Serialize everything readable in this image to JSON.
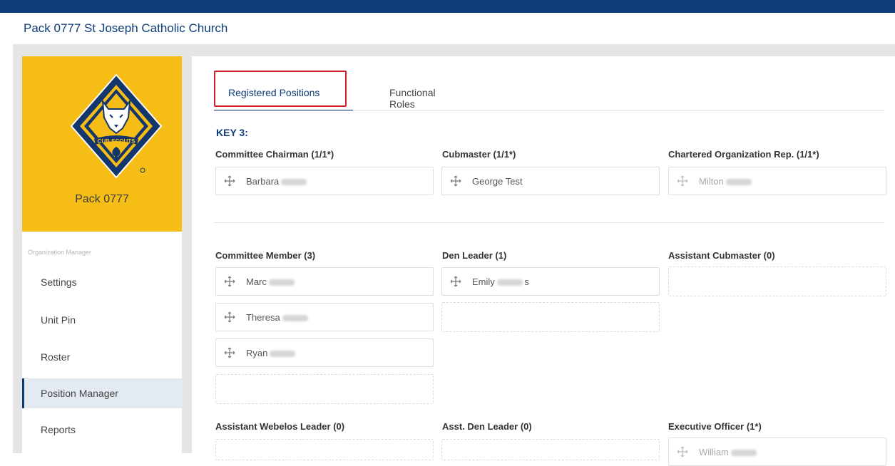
{
  "header": {
    "title": "Pack 0777 St Joseph Catholic Church"
  },
  "unit": {
    "name": "Pack 0777",
    "badge_text": "CUB SCOUTS"
  },
  "sidebar": {
    "heading": "Organization Manager",
    "items": [
      {
        "label": "Settings"
      },
      {
        "label": "Unit Pin"
      },
      {
        "label": "Roster"
      },
      {
        "label": "Position Manager",
        "active": true
      },
      {
        "label": "Reports"
      }
    ]
  },
  "tabs": [
    {
      "label": "Registered Positions",
      "active": true
    },
    {
      "label": "Functional Roles"
    }
  ],
  "sections": {
    "key3": {
      "heading": "KEY 3:",
      "positions": [
        {
          "label": "Committee Chairman (1/1*)",
          "members": [
            "Barbara"
          ]
        },
        {
          "label": "Cubmaster (1/1*)",
          "members": [
            "George Test"
          ]
        },
        {
          "label": "Chartered Organization Rep. (1/1*)",
          "members": [
            "Milton"
          ]
        }
      ]
    },
    "leaders": {
      "positions": [
        {
          "label": "Committee Member (3)",
          "members": [
            "Marc",
            "Theresa",
            "Ryan"
          ]
        },
        {
          "label": "Den Leader (1)",
          "members": [
            "Emily",
            "s"
          ]
        },
        {
          "label": "Assistant Cubmaster (0)",
          "members": []
        },
        {
          "label": "Assistant Webelos Leader (0)",
          "members": []
        },
        {
          "label": "Asst. Den Leader (0)",
          "members": []
        },
        {
          "label": "Executive Officer (1*)",
          "members": [
            "William"
          ]
        }
      ]
    }
  },
  "colors": {
    "brand_navy": "#0d3c78",
    "badge_yellow": "#f6bd17",
    "focus_red": "#d0202a"
  }
}
